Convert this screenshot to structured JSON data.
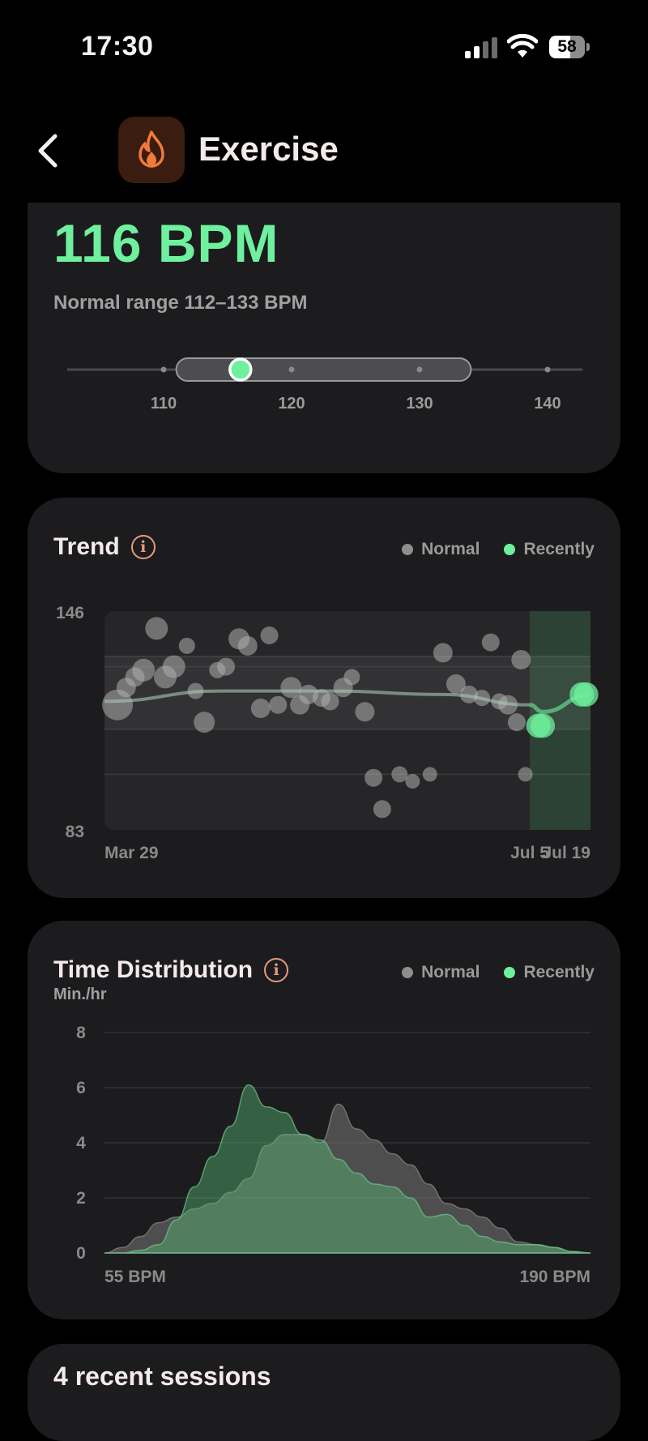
{
  "status_bar": {
    "time": "17:30",
    "battery": "58"
  },
  "nav": {
    "title": "Exercise",
    "icon": "flame-icon"
  },
  "current": {
    "value_label": "116 BPM",
    "value": 116,
    "range_label": "Normal range 112–133 BPM",
    "range_low": 112,
    "range_high": 133,
    "scale_ticks": [
      110,
      120,
      130,
      140
    ]
  },
  "trend": {
    "title": "Trend",
    "legend": {
      "normal": "Normal",
      "recently": "Recently"
    },
    "y_max_label": "146",
    "y_min_label": "83",
    "x_labels": [
      "Mar 29",
      "Jul 5",
      "Jul 19"
    ]
  },
  "distribution": {
    "title": "Time Distribution",
    "legend": {
      "normal": "Normal",
      "recently": "Recently"
    },
    "unit": "Min./hr",
    "y_ticks": [
      "8",
      "6",
      "4",
      "2",
      "0"
    ],
    "x_start_label": "55 BPM",
    "x_end_label": "190 BPM"
  },
  "sessions": {
    "title": "4 recent sessions"
  },
  "colors": {
    "accent_green": "#6ef09e",
    "normal_gray": "#8e8e8e",
    "card_bg": "#1c1c1e",
    "icon_orange": "#f07a3a"
  },
  "chart_data": [
    {
      "type": "scatter",
      "title": "Trend",
      "ylim": [
        83,
        146
      ],
      "x_range": [
        "Mar 29",
        "Jul 19"
      ],
      "normal_band": [
        112,
        133
      ],
      "series": [
        {
          "name": "Normal",
          "x": [
            "Apr 1",
            "Apr 3",
            "Apr 5",
            "Apr 7",
            "Apr 10",
            "Apr 12",
            "Apr 14",
            "Apr 17",
            "Apr 19",
            "Apr 21",
            "Apr 24",
            "Apr 26",
            "Apr 29",
            "May 1",
            "May 4",
            "May 6",
            "May 8",
            "May 11",
            "May 13",
            "May 15",
            "May 18",
            "May 20",
            "May 23",
            "May 25",
            "May 28",
            "May 30",
            "Jun 1",
            "Jun 5",
            "Jun 8",
            "Jun 12",
            "Jun 15",
            "Jun 18",
            "Jun 21",
            "Jun 24",
            "Jun 26",
            "Jun 28",
            "Jun 30",
            "Jul 2",
            "Jul 3",
            "Jul 4"
          ],
          "y": [
            119,
            124,
            127,
            129,
            141,
            127,
            130,
            136,
            123,
            114,
            129,
            130,
            138,
            136,
            118,
            139,
            119,
            124,
            119,
            122,
            121,
            120,
            124,
            127,
            117,
            98,
            89,
            99,
            97,
            99,
            134,
            125,
            122,
            121,
            137,
            120,
            119,
            114,
            132,
            99
          ]
        },
        {
          "name": "Recently",
          "x": [
            "Jul 7",
            "Jul 8",
            "Jul 17",
            "Jul 18"
          ],
          "y": [
            113,
            113,
            122,
            122
          ]
        }
      ],
      "trend_line": {
        "x": [
          "Mar 29",
          "Apr 25",
          "May 20",
          "Jun 15",
          "Jul 5",
          "Jul 8",
          "Jul 19"
        ],
        "y": [
          120,
          123,
          123,
          122,
          119,
          117,
          122
        ]
      }
    },
    {
      "type": "area",
      "title": "Time Distribution",
      "ylabel": "Min./hr",
      "ylim": [
        0,
        8
      ],
      "x": [
        55,
        60,
        65,
        70,
        75,
        80,
        85,
        90,
        95,
        100,
        105,
        110,
        115,
        120,
        125,
        130,
        135,
        140,
        145,
        150,
        155,
        160,
        165,
        170,
        175,
        180,
        185,
        190
      ],
      "series": [
        {
          "name": "Normal",
          "values": [
            0,
            0.2,
            0.6,
            1.1,
            1.3,
            1.6,
            1.8,
            2.2,
            2.7,
            3.9,
            4.3,
            4.3,
            4.0,
            5.4,
            4.5,
            4.1,
            3.6,
            3.2,
            2.5,
            1.8,
            1.6,
            1.3,
            0.9,
            0.4,
            0.3,
            0.2,
            0.05,
            0
          ]
        },
        {
          "name": "Recently",
          "values": [
            0,
            0,
            0.1,
            0.3,
            1.2,
            2.4,
            3.5,
            4.6,
            6.1,
            5.3,
            5.1,
            4.3,
            4.1,
            3.4,
            2.9,
            2.5,
            2.4,
            2.0,
            1.3,
            1.4,
            1.0,
            0.6,
            0.4,
            0.3,
            0.3,
            0.2,
            0.05,
            0
          ]
        }
      ]
    }
  ]
}
